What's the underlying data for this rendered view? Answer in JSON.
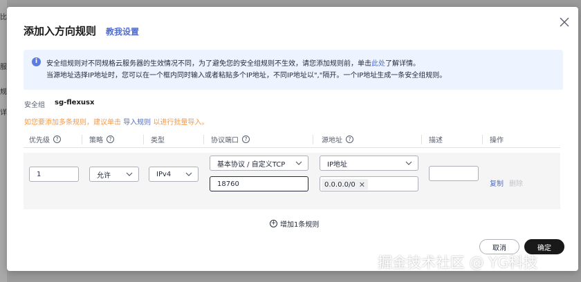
{
  "background": {
    "fragments": [
      "比",
      "服务",
      "规",
      "详"
    ]
  },
  "dialog": {
    "title": "添加入方向规则",
    "teach_link": "教我设置",
    "info": {
      "line1_pre": "安全组规则对不同规格云服务器的生效情况不同，为了避免您的安全组规则不生效，请您添加规则前，单击",
      "line1_link": "此处",
      "line1_post": "了解详情。",
      "line2": "当源地址选择IP地址时，您可以在一个框内同时输入或者粘贴多个IP地址，不同IP地址以\",\"隔开。一个IP地址生成一条安全组规则。"
    },
    "security_group_label": "安全组",
    "security_group_value": "sg-flexusx",
    "tip_pre": "如您要添加多条规则，建议单击",
    "tip_link": "导入规则",
    "tip_post": "以进行批量导入。",
    "columns": [
      "优先级",
      "策略",
      "类型",
      "协议端口",
      "源地址",
      "描述",
      "操作"
    ],
    "row": {
      "priority": "1",
      "policy": "允许",
      "type": "IPv4",
      "protocol": "基本协议 / 自定义TCP",
      "port": "18760",
      "source_type": "IP地址",
      "source_ip": "0.0.0.0/0",
      "description": "",
      "action_copy": "复制",
      "action_delete": "删除"
    },
    "add_rule": "增加1条规则",
    "cancel": "取消",
    "confirm": "确定"
  },
  "watermark": "掘金技术社区 @ YG科技",
  "colors": {
    "link": "#526ecc",
    "warning": "#fa9841",
    "info_bg": "#edf3ff",
    "primary_button": "#191919"
  }
}
